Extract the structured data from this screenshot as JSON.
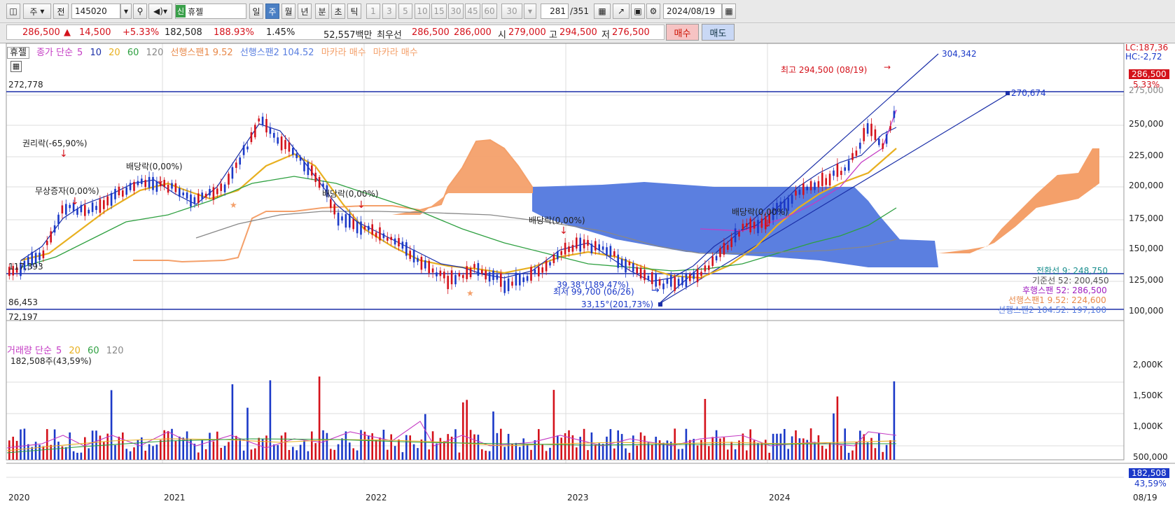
{
  "toolbar": {
    "period_type": "주",
    "all_label": "전",
    "code": "145020",
    "new_badge": "신",
    "name": "휴젤",
    "periods": [
      "일",
      "주",
      "월",
      "년"
    ],
    "intraday": [
      "분",
      "초",
      "틱"
    ],
    "minutes": [
      "1",
      "3",
      "5",
      "10",
      "15",
      "30",
      "45",
      "60"
    ],
    "custom_min": "30",
    "count": "281",
    "total": "/351",
    "date": "2024/08/19"
  },
  "quote": {
    "price": "286,500",
    "arrow": "▲",
    "change": "14,500",
    "change_pct": "+5.33%",
    "volume": "182,508",
    "vol_ratio": "188.93%",
    "turnover": "1.45%",
    "amount": "52,557백만",
    "best_label": "최우선",
    "ask": "286,500",
    "bid": "286,000",
    "open_label": "시",
    "open": "279,000",
    "high_label": "고",
    "high": "294,500",
    "low_label": "저",
    "low": "276,500",
    "buy": "매수",
    "sell": "매도"
  },
  "price_legend": {
    "name": "휴젤",
    "close_ma": "종가 단순",
    "ma": [
      "5",
      "10",
      "20",
      "60",
      "120"
    ],
    "span1": "선행스팬1 9.52",
    "span2": "선행스팬2 104.52",
    "makara1": "마카라 매수",
    "makara2": "마카라 매수"
  },
  "volume_legend": {
    "label": "거래량 단순",
    "ma": [
      "5",
      "20",
      "60",
      "120"
    ],
    "current": "182,508주(43,59%)"
  },
  "right_top": {
    "lc": "LC:187,36",
    "hc": "HC:-2,72"
  },
  "price_axis": [
    "275,000",
    "250,000",
    "225,000",
    "200,000",
    "175,000",
    "150,000",
    "125,000",
    "100,000"
  ],
  "volume_axis": [
    "2,000K",
    "1,500K",
    "1,000K",
    "500,000"
  ],
  "x_axis": [
    "2020",
    "2021",
    "2022",
    "2023",
    "2024",
    "08/19"
  ],
  "badges": {
    "price": "286,500",
    "pct": "5.33%",
    "vol": "182,508",
    "vol_pct": "43,59%"
  },
  "annotations": {
    "high": "최고 294,500 (08/19)",
    "low": "최저 99,700 (06/26)",
    "trend_top": "304,342",
    "trend_mid": "270,674",
    "level_272": "272,778",
    "level_117": "117,393",
    "level_86": "86,453",
    "level_72": "72,197",
    "rights": "권리락(-65,90%)",
    "bonus": "무상증자(0,00%)",
    "div1": "배당락(0,00%)",
    "div2": "배당락(0,00%)",
    "div3": "배당락(0,00%)",
    "div4": "배당락(0,00%)",
    "angle1": "39,38°(189,47%)",
    "angle2": "33,15°(201,73%)"
  },
  "ichimoku_values": [
    {
      "text": "전환선 9: 248,750",
      "color": "#1b8f8f"
    },
    {
      "text": "기준선 52: 200,450",
      "color": "#555555"
    },
    {
      "text": "후행스팬 52: 286,500",
      "color": "#a020c0"
    },
    {
      "text": "선행스팬1 9.52: 224,600",
      "color": "#e8894a"
    },
    {
      "text": "선행스팬2 104.52: 197,100",
      "color": "#5a7fe0"
    }
  ]
}
